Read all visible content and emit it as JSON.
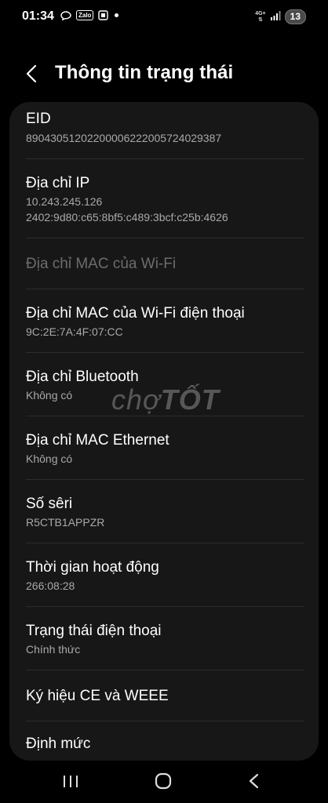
{
  "status_bar": {
    "time": "01:34",
    "notification_icons": [
      "message-icon",
      "zalo-icon",
      "screenshot-app-icon",
      "dot-icon"
    ],
    "zalo_label": "Zalo",
    "network_label": "4G+",
    "battery_level": "13"
  },
  "header": {
    "title": "Thông tin trạng thái"
  },
  "items": [
    {
      "title": "EID",
      "subtitle": "89043051202200006222005724029387"
    },
    {
      "title": "Địa chỉ IP",
      "subtitle": "10.243.245.126",
      "subtitle2": "2402:9d80:c65:8bf5:c489:3bcf:c25b:4626"
    },
    {
      "title": "Địa chỉ MAC của Wi-Fi",
      "disabled": true
    },
    {
      "title": "Địa chỉ MAC của Wi-Fi điện thoại",
      "subtitle": "9C:2E:7A:4F:07:CC"
    },
    {
      "title": "Địa chỉ Bluetooth",
      "subtitle": "Không có"
    },
    {
      "title": "Địa chỉ MAC Ethernet",
      "subtitle": "Không có"
    },
    {
      "title": "Số sêri",
      "subtitle": "R5CTB1APPZR"
    },
    {
      "title": "Thời gian hoạt động",
      "subtitle": "266:08:28"
    },
    {
      "title": "Trạng thái điện thoại",
      "subtitle": "Chính thức"
    },
    {
      "title": "Ký hiệu CE và WEEE"
    },
    {
      "title": "Định mức"
    }
  ],
  "watermark": {
    "part1": "chợ",
    "part2": "TỐT"
  },
  "navbar": {
    "icons": [
      "recents-icon",
      "home-icon",
      "back-icon"
    ]
  },
  "colors": {
    "background": "#000000",
    "card": "#171717",
    "subtitle": "#a9a9a9",
    "disabled": "#6c6c6c"
  }
}
